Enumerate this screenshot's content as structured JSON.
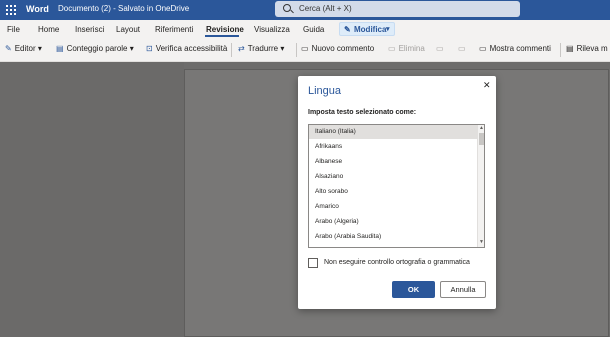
{
  "titlebar": {
    "app_name": "Word",
    "doc_status": "Documento (2)  -  Salvato in OneDrive",
    "search_placeholder": "Cerca (Alt + X)"
  },
  "menu": {
    "items": [
      "File",
      "Home",
      "Inserisci",
      "Layout",
      "Riferimenti",
      "Revisione",
      "Visualizza",
      "Guida"
    ],
    "active": "Revisione",
    "mode_button": "Modifica"
  },
  "toolbar": {
    "editor": "Editor",
    "word_count": "Conteggio parole",
    "accessibility": "Verifica accessibilità",
    "translate": "Tradurre",
    "new_comment": "Nuovo commento",
    "delete": "Elimina",
    "show_comments": "Mostra commenti",
    "track_changes": "Rileva m"
  },
  "dialog": {
    "title": "Lingua",
    "label": "Imposta testo selezionato come:",
    "languages": [
      "Italiano (Italia)",
      "Afrikaans",
      "Albanese",
      "Alsaziano",
      "Alto sorabo",
      "Amarico",
      "Arabo (Algeria)",
      "Arabo (Arabia Saudita)"
    ],
    "selected": "Italiano (Italia)",
    "checkbox_label": "Non eseguire controllo ortografia o grammatica",
    "checkbox_checked": false,
    "ok_label": "OK",
    "cancel_label": "Annulla"
  },
  "colors": {
    "brand": "#2b579a",
    "overlay": "#6d6c6b"
  }
}
